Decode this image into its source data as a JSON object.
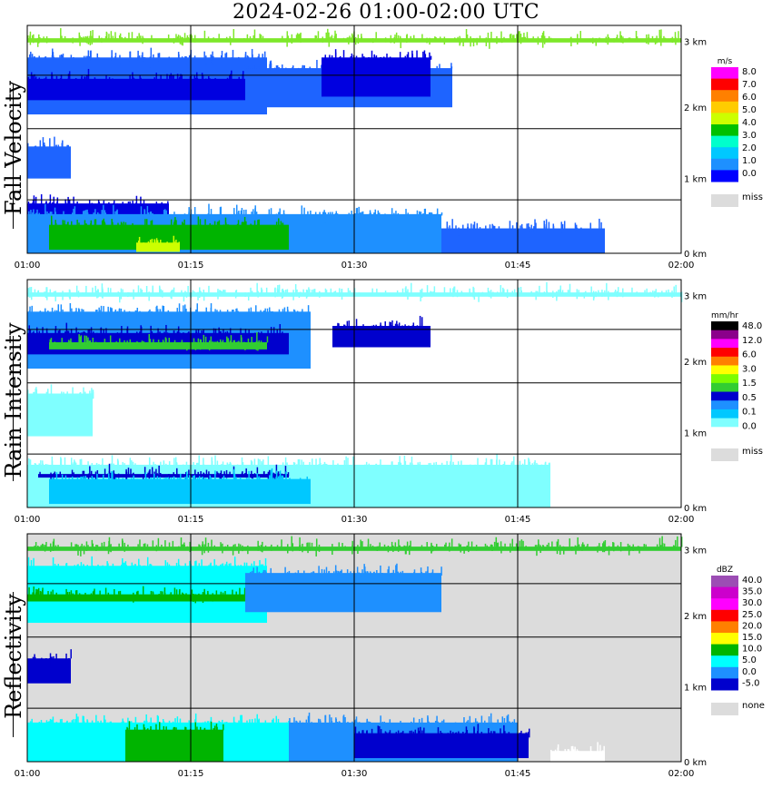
{
  "title": "2024-02-26  01:00-02:00 UTC",
  "colors": {
    "miss": "#dcdcdc",
    "grid": "#000000"
  },
  "chart_data": [
    {
      "type": "heatmap",
      "ylabel": "Fall Velocity",
      "x_ticks": [
        "01:00",
        "01:15",
        "01:30",
        "01:45",
        "02:00"
      ],
      "y_ticks": [
        "0 km",
        "1 km",
        "2 km",
        "3 km"
      ],
      "xlim": [
        0,
        60
      ],
      "ylim": [
        0,
        3.2
      ],
      "legend_unit": "m/s",
      "legend_labels": [
        "8.0",
        "7.0",
        "6.0",
        "5.0",
        "4.0",
        "3.0",
        "2.0",
        "1.0",
        "0.0"
      ],
      "legend_colors": [
        "#ff00ff",
        "#ff0000",
        "#ff8000",
        "#ffcc00",
        "#ccff00",
        "#00c000",
        "#00ffcc",
        "#00c8ff",
        "#1e90ff",
        "#0000ff"
      ],
      "legend_miss": "miss",
      "background": "#ffffff",
      "bands": [
        {
          "t0": 0,
          "t1": 60,
          "h0": 2.96,
          "h1": 3.02,
          "color": "#7ee82a"
        },
        {
          "t0": 0,
          "t1": 22,
          "h0": 1.95,
          "h1": 2.75,
          "color": "#1e64ff"
        },
        {
          "t0": 0,
          "t1": 20,
          "h0": 2.15,
          "h1": 2.45,
          "color": "#0000e0"
        },
        {
          "t0": 20,
          "t1": 39,
          "h0": 2.05,
          "h1": 2.6,
          "color": "#1e64ff"
        },
        {
          "t0": 27,
          "t1": 37,
          "h0": 2.2,
          "h1": 2.75,
          "color": "#0000e0"
        },
        {
          "t0": 0,
          "t1": 4,
          "h0": 1.05,
          "h1": 1.5,
          "color": "#1e64ff"
        },
        {
          "t0": 0,
          "t1": 13,
          "h0": 0.35,
          "h1": 0.7,
          "color": "#0000e0"
        },
        {
          "t0": 0,
          "t1": 38,
          "h0": 0.0,
          "h1": 0.55,
          "color": "#1e90ff"
        },
        {
          "t0": 2,
          "t1": 24,
          "h0": 0.05,
          "h1": 0.4,
          "color": "#00b400"
        },
        {
          "t0": 10,
          "t1": 14,
          "h0": 0.02,
          "h1": 0.15,
          "color": "#ccff00"
        },
        {
          "t0": 38,
          "t1": 53,
          "h0": 0.0,
          "h1": 0.35,
          "color": "#1e64ff"
        }
      ]
    },
    {
      "type": "heatmap",
      "ylabel": "Rain Intensity",
      "x_ticks": [
        "01:00",
        "01:15",
        "01:30",
        "01:45",
        "02:00"
      ],
      "y_ticks": [
        "0 km",
        "1 km",
        "2 km",
        "3 km"
      ],
      "xlim": [
        0,
        60
      ],
      "ylim": [
        0,
        3.2
      ],
      "legend_unit": "mm/hr",
      "legend_labels": [
        "48.0",
        "12.0",
        "6.0",
        "3.0",
        "1.5",
        "0.5",
        "0.1",
        "0.0"
      ],
      "legend_colors": [
        "#000000",
        "#8b008b",
        "#ff00ff",
        "#ff0000",
        "#ff8000",
        "#ffff00",
        "#7cfc00",
        "#32cd32",
        "#0000cd",
        "#1e90ff",
        "#00c8ff",
        "#7fffff",
        "#ffffff"
      ],
      "legend_miss": "miss",
      "background": "#ffffff",
      "bands": [
        {
          "t0": 0,
          "t1": 60,
          "h0": 2.96,
          "h1": 3.02,
          "color": "#7fffff"
        },
        {
          "t0": 0,
          "t1": 26,
          "h0": 1.95,
          "h1": 2.75,
          "color": "#1e90ff"
        },
        {
          "t0": 0,
          "t1": 24,
          "h0": 2.15,
          "h1": 2.45,
          "color": "#0000cd"
        },
        {
          "t0": 2,
          "t1": 22,
          "h0": 2.22,
          "h1": 2.32,
          "color": "#32cd32"
        },
        {
          "t0": 28,
          "t1": 37,
          "h0": 2.25,
          "h1": 2.55,
          "color": "#0000cd"
        },
        {
          "t0": 0,
          "t1": 6,
          "h0": 1.0,
          "h1": 1.6,
          "color": "#7fffff"
        },
        {
          "t0": 0,
          "t1": 48,
          "h0": 0.0,
          "h1": 0.6,
          "color": "#7fffff"
        },
        {
          "t0": 1,
          "t1": 24,
          "h0": 0.42,
          "h1": 0.47,
          "color": "#0000cd"
        },
        {
          "t0": 2,
          "t1": 26,
          "h0": 0.05,
          "h1": 0.4,
          "color": "#00c8ff"
        }
      ]
    },
    {
      "type": "heatmap",
      "ylabel": "Reflectivity",
      "x_ticks": [
        "01:00",
        "01:15",
        "01:30",
        "01:45",
        "02:00"
      ],
      "y_ticks": [
        "0 km",
        "1 km",
        "2 km",
        "3 km"
      ],
      "xlim": [
        0,
        60
      ],
      "ylim": [
        0,
        3.2
      ],
      "legend_unit": "dBZ",
      "legend_labels": [
        "40.0",
        "35.0",
        "30.0",
        "25.0",
        "20.0",
        "15.0",
        "10.0",
        "5.0",
        "0.0",
        "-5.0"
      ],
      "legend_colors": [
        "#9c4db4",
        "#cc00cc",
        "#ff00ff",
        "#ff0000",
        "#ff8000",
        "#ffff00",
        "#00b400",
        "#00ffff",
        "#1e90ff",
        "#0000cd"
      ],
      "legend_miss": "none",
      "background": "#dcdcdc",
      "bands": [
        {
          "t0": 0,
          "t1": 60,
          "h0": 2.96,
          "h1": 3.02,
          "color": "#32cd32"
        },
        {
          "t0": 0,
          "t1": 22,
          "h0": 1.95,
          "h1": 2.75,
          "color": "#00ffff"
        },
        {
          "t0": 0,
          "t1": 20,
          "h0": 2.25,
          "h1": 2.35,
          "color": "#00b400"
        },
        {
          "t0": 20,
          "t1": 38,
          "h0": 2.1,
          "h1": 2.65,
          "color": "#1e90ff"
        },
        {
          "t0": 0,
          "t1": 4,
          "h0": 1.1,
          "h1": 1.45,
          "color": "#0000cd"
        },
        {
          "t0": 0,
          "t1": 24,
          "h0": 0.0,
          "h1": 0.55,
          "color": "#00ffff"
        },
        {
          "t0": 9,
          "t1": 18,
          "h0": 0.0,
          "h1": 0.45,
          "color": "#00b400"
        },
        {
          "t0": 24,
          "t1": 45,
          "h0": 0.0,
          "h1": 0.55,
          "color": "#1e90ff"
        },
        {
          "t0": 30,
          "t1": 46,
          "h0": 0.05,
          "h1": 0.4,
          "color": "#0000cd"
        },
        {
          "t0": 48,
          "t1": 53,
          "h0": 0.0,
          "h1": 0.15,
          "color": "#ffffff"
        }
      ]
    }
  ]
}
